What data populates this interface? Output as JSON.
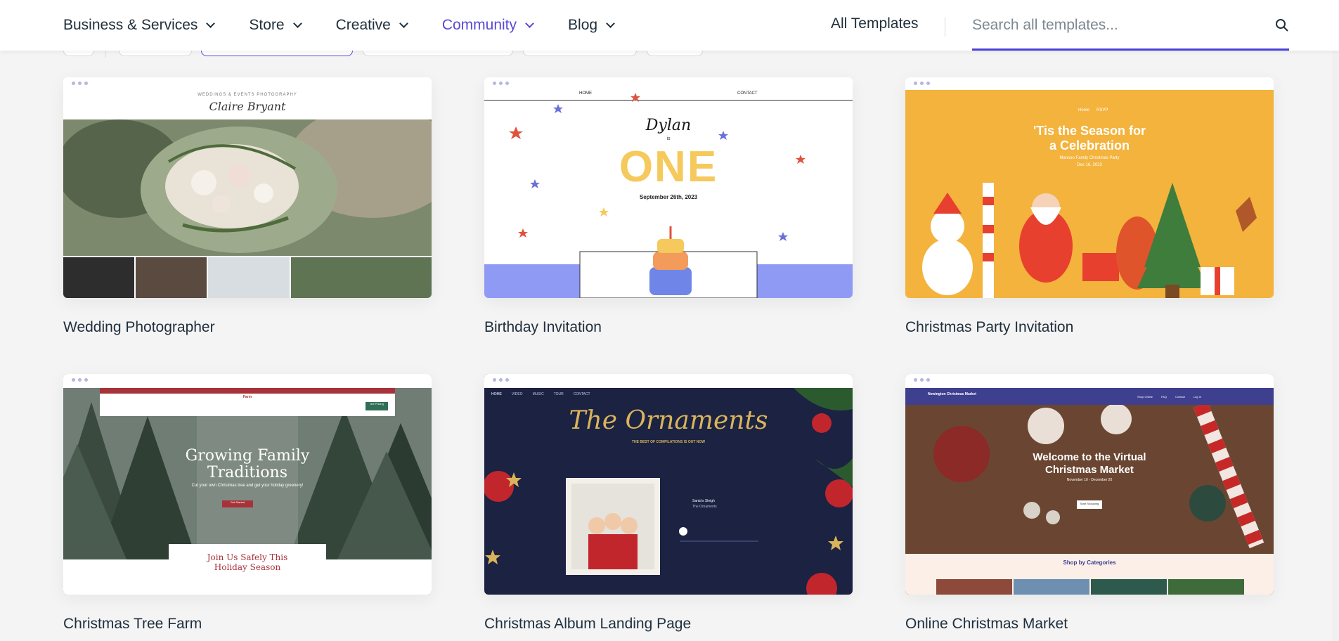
{
  "nav": {
    "items": [
      {
        "label": "Business & Services",
        "active": false
      },
      {
        "label": "Store",
        "active": false
      },
      {
        "label": "Creative",
        "active": false
      },
      {
        "label": "Community",
        "active": true
      },
      {
        "label": "Blog",
        "active": false
      }
    ],
    "all_templates": "All Templates",
    "search_placeholder": "Search all templates..."
  },
  "colors": {
    "accent": "#5a48d5",
    "underline": "#4a3fd6"
  },
  "cards": [
    {
      "title": "Wedding Photographer",
      "preview": {
        "kicker": "WEDDINGS & EVENTS PHOTOGRAPHY",
        "heading": "Claire Bryant"
      }
    },
    {
      "title": "Birthday Invitation",
      "preview": {
        "nav_home": "HOME",
        "nav_contact": "CONTACT",
        "name": "Dylan",
        "is": "is",
        "age": "ONE",
        "date": "September 26th, 2023"
      }
    },
    {
      "title": "Christmas Party Invitation",
      "preview": {
        "nav_home": "Home",
        "nav_rsvp": "RSVP",
        "heading_line1": "'Tis the Season for",
        "heading_line2": "a Celebration",
        "sub": "Mansoo Family Christmas Party",
        "date": "Dec 16, 2023"
      }
    },
    {
      "title": "Christmas Tree Farm",
      "preview": {
        "brand": "Two Pines Xmas Tree Farm",
        "cta": "Get Pricing",
        "heading_line1": "Growing Family",
        "heading_line2": "Traditions",
        "sub": "Cut your own Christmas tree and get your holiday greenery!",
        "btn": "Get Started",
        "footer_line1": "Join Us Safely This",
        "footer_line2": "Holiday Season"
      }
    },
    {
      "title": "Christmas Album Landing Page",
      "preview": {
        "nav": [
          "HOME",
          "VIDEO",
          "MUSIC",
          "TOUR",
          "CONTACT"
        ],
        "heading": "The Ornaments",
        "sub": "THE BEST OF COMPILATIONS IS OUT NOW",
        "track": "Santa's Sleigh",
        "artist": "The Ornaments"
      }
    },
    {
      "title": "Online Christmas Market",
      "preview": {
        "brand": "Newington Christmas Market",
        "nav": [
          "Shop Online",
          "FAQ",
          "Contact",
          "Log In"
        ],
        "heading_line1": "Welcome to the Virtual",
        "heading_line2": "Christmas Market",
        "dates": "November 10 - December 20",
        "btn": "Start Shopping",
        "categories": "Shop by Categories"
      }
    }
  ]
}
